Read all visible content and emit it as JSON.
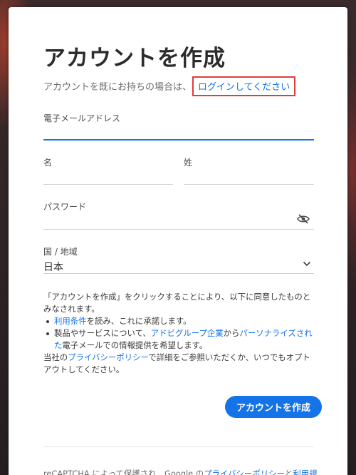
{
  "page": {
    "title": "アカウントを作成"
  },
  "signin": {
    "prompt": "アカウントを既にお持ちの場合は、",
    "link": "ログインしてください"
  },
  "form": {
    "email_label": "電子メールアドレス",
    "first_name_label": "名",
    "last_name_label": "姓",
    "password_label": "パスワード",
    "country_label": "国 / 地域",
    "country_value": "日本"
  },
  "terms": {
    "intro": "「アカウントを作成」をクリックすることにより、以下に同意したものとみなされます。",
    "bullet1_link": "利用条件",
    "bullet1_text": "を読み、これに承諾します。",
    "bullet2_prefix": "製品やサービスについて、",
    "bullet2_link1": "アドビグループ企業",
    "bullet2_mid": "から",
    "bullet2_link2": "パーソナライズされた",
    "bullet2_suffix": "電子メールでの情報提供を希望します。",
    "privacy_prefix": "当社の",
    "privacy_link": "プライバシーポリシー",
    "privacy_suffix": "で詳細をご参照いただくか、いつでもオプトアウトしてください。"
  },
  "submit": {
    "label": "アカウントを作成"
  },
  "recaptcha": {
    "prefix": "reCAPTCHA によって保護され、Google の",
    "privacy_link": "プライバシーポリシー",
    "mid": "と",
    "terms_link": "利用規"
  },
  "colors": {
    "accent": "#1473e6",
    "highlight_border": "#e03c3c",
    "card_background": "#ffffff",
    "backdrop": "#2a2324"
  },
  "icons": {
    "password_toggle": "eye-slash-icon",
    "country_dropdown": "chevron-down-icon"
  }
}
